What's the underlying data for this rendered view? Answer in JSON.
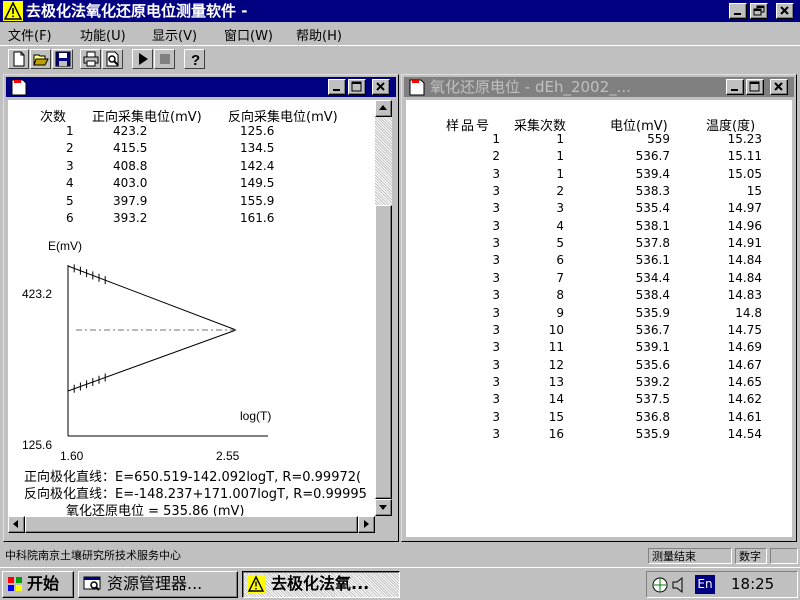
{
  "app": {
    "title": "去极化法氧化还原电位测量软件  -",
    "menu": [
      "文件(F)",
      "功能(U)",
      "显示(V)",
      "窗口(W)",
      "帮助(H)"
    ]
  },
  "left_window": {
    "table": {
      "headers": [
        "次数",
        "正向采集电位(mV)",
        "反向采集电位(mV)"
      ],
      "rows": [
        [
          "1",
          "423.2",
          "125.6"
        ],
        [
          "2",
          "415.5",
          "134.5"
        ],
        [
          "3",
          "408.8",
          "142.4"
        ],
        [
          "4",
          "403.0",
          "149.5"
        ],
        [
          "5",
          "397.9",
          "155.9"
        ],
        [
          "6",
          "393.2",
          "161.6"
        ]
      ]
    },
    "chart_data": {
      "type": "line",
      "ylabel": "E(mV)",
      "xlabel": "log(T)",
      "ytick_labels": [
        "423.2",
        "125.6"
      ],
      "xtick_labels": [
        "1.60",
        "2.55"
      ],
      "xlim": [
        1.6,
        2.55
      ],
      "ylim": [
        125.6,
        423.2
      ],
      "series": [
        {
          "x": [
            1.6,
            2.55
          ],
          "y": [
            423.2,
            270.8
          ]
        },
        {
          "x": [
            1.6,
            2.55
          ],
          "y": [
            125.6,
            270.8
          ]
        }
      ],
      "intersection_y": 270.8
    },
    "fit1": "正向极化直线：E=650.519-142.092logT,   R=0.99972(",
    "fit2": "反向极化直线：E=-148.237+171.007logT,   R=0.99995",
    "result": "氧化还原电位 = 535.86 (mV)"
  },
  "right_window": {
    "title": "氧化还原电位  - dEh_2002_...",
    "headers": [
      "样品号",
      "采集次数",
      "电位(mV)",
      "温度(度)"
    ],
    "rows": [
      [
        "1",
        "1",
        "559",
        "15.23"
      ],
      [
        "2",
        "1",
        "536.7",
        "15.11"
      ],
      [
        "3",
        "1",
        "539.4",
        "15.05"
      ],
      [
        "3",
        "2",
        "538.3",
        "15"
      ],
      [
        "3",
        "3",
        "535.4",
        "14.97"
      ],
      [
        "3",
        "4",
        "538.1",
        "14.96"
      ],
      [
        "3",
        "5",
        "537.8",
        "14.91"
      ],
      [
        "3",
        "6",
        "536.1",
        "14.84"
      ],
      [
        "3",
        "7",
        "534.4",
        "14.84"
      ],
      [
        "3",
        "8",
        "538.4",
        "14.83"
      ],
      [
        "3",
        "9",
        "535.9",
        "14.8"
      ],
      [
        "3",
        "10",
        "536.7",
        "14.75"
      ],
      [
        "3",
        "11",
        "539.1",
        "14.69"
      ],
      [
        "3",
        "12",
        "535.6",
        "14.67"
      ],
      [
        "3",
        "13",
        "539.2",
        "14.65"
      ],
      [
        "3",
        "14",
        "537.5",
        "14.62"
      ],
      [
        "3",
        "15",
        "536.8",
        "14.61"
      ],
      [
        "3",
        "16",
        "535.9",
        "14.54"
      ]
    ]
  },
  "status": {
    "org": "中科院南京土壤研究所技术服务中心",
    "state": "测量结束",
    "mode": "数字"
  },
  "taskbar": {
    "start": "开始",
    "tasks": [
      "资源管理器...",
      "去极化法氧..."
    ],
    "lang": "En",
    "time": "18:25"
  },
  "colors": {
    "titlebar_active": "#000080",
    "titlebar_inactive": "#808080",
    "face": "#c0c0c0",
    "warning_icon": "#ffff00"
  }
}
